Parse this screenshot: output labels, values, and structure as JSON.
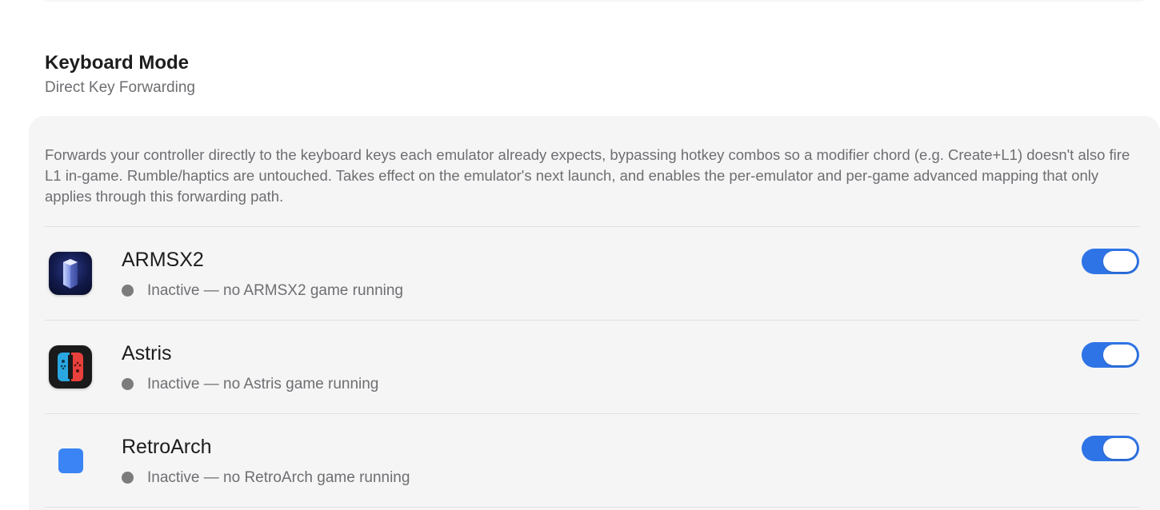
{
  "section": {
    "title": "Keyboard Mode",
    "subtitle": "Direct Key Forwarding",
    "description": "Forwards your controller directly to the keyboard keys each emulator already expects, bypassing hotkey combos so a modifier chord (e.g. Create+L1) doesn't also fire L1 in-game. Rumble/haptics are untouched. Takes effect on the emulator's next launch, and enables the per-emulator and per-game advanced mapping that only applies through this forwarding path."
  },
  "emulators": [
    {
      "name": "ARMSX2",
      "status": "Inactive — no ARMSX2 game running",
      "enabled": true,
      "icon": "armsx2-icon"
    },
    {
      "name": "Astris",
      "status": "Inactive — no Astris game running",
      "enabled": true,
      "icon": "astris-icon"
    },
    {
      "name": "RetroArch",
      "status": "Inactive — no RetroArch game running",
      "enabled": true,
      "icon": "retroarch-icon"
    }
  ],
  "colors": {
    "accent": "#2f74e6",
    "status_inactive": "#7c7c7c",
    "card_background": "#f5f5f5"
  }
}
